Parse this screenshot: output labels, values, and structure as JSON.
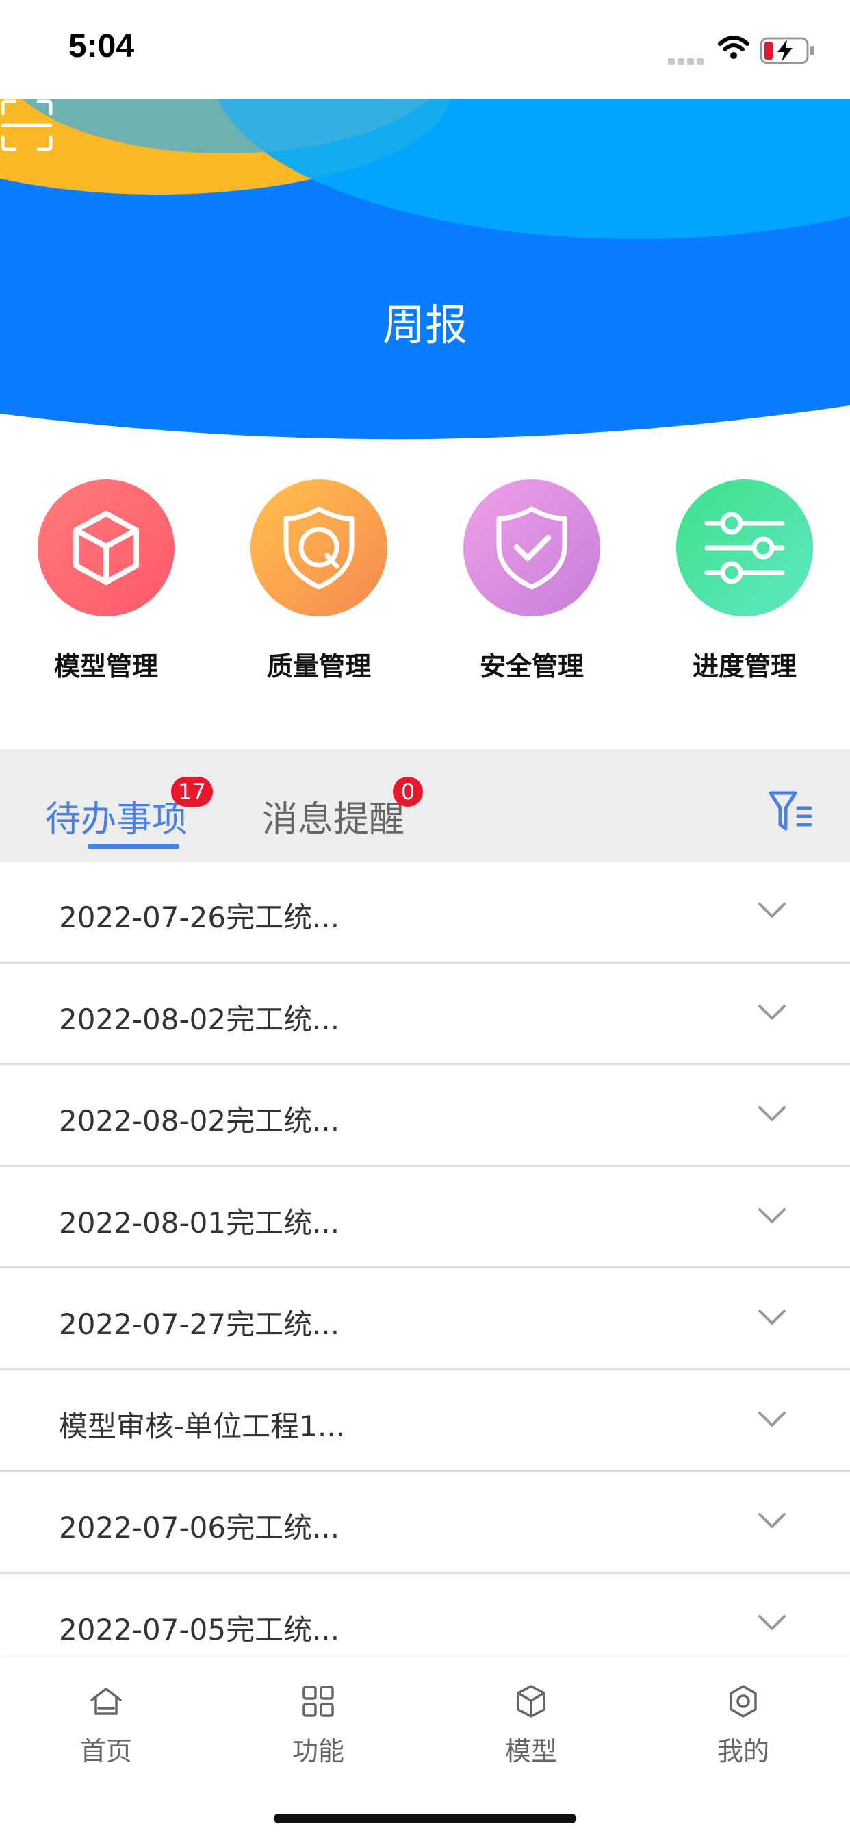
{
  "status_bar": {
    "time": "5:04"
  },
  "hero": {
    "title": "周报"
  },
  "quick_functions": [
    {
      "label": "模型管理",
      "icon": "cube-icon",
      "color": "#ff6b6b"
    },
    {
      "label": "质量管理",
      "icon": "shield-q-icon",
      "color": "#f9a04a"
    },
    {
      "label": "安全管理",
      "icon": "shield-check-icon",
      "color": "#d98be0"
    },
    {
      "label": "进度管理",
      "icon": "sliders-icon",
      "color": "#4fe0a0"
    }
  ],
  "tabs": [
    {
      "label": "待办事项",
      "badge": "17",
      "active": true
    },
    {
      "label": "消息提醒",
      "badge": "0",
      "active": false
    }
  ],
  "list": [
    "2022-07-26完工统...",
    "2022-08-02完工统...",
    "2022-08-02完工统...",
    "2022-08-01完工统...",
    "2022-07-27完工统...",
    "模型审核-单位工程1...",
    "2022-07-06完工统...",
    "2022-07-05完工统..."
  ],
  "bottom_nav": [
    {
      "label": "首页",
      "icon": "home-icon"
    },
    {
      "label": "功能",
      "icon": "grid-icon"
    },
    {
      "label": "模型",
      "icon": "cube-icon"
    },
    {
      "label": "我的",
      "icon": "gear-icon"
    }
  ],
  "colors": {
    "accent": "#4a80e0",
    "hero_blue": "#0a7cff",
    "badge_red": "#e8172c"
  }
}
